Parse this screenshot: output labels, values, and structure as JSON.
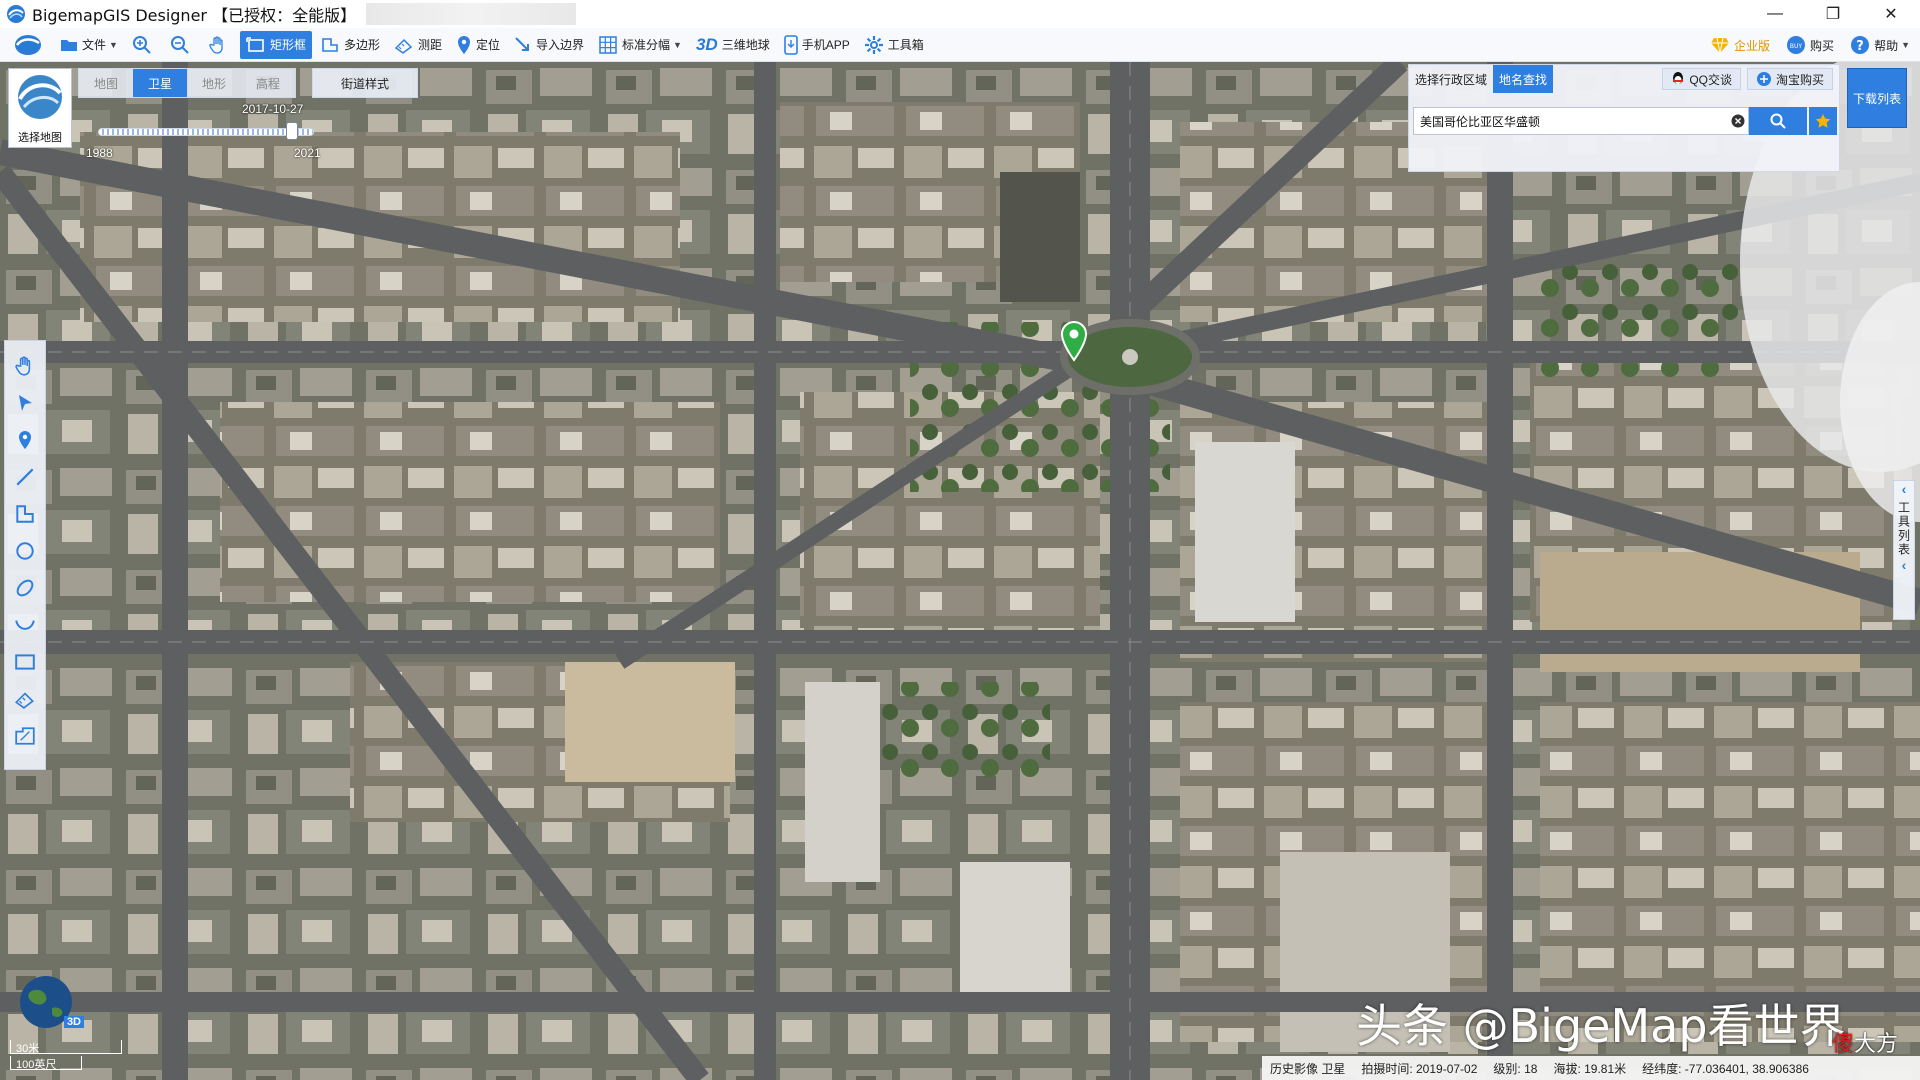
{
  "window": {
    "title": "BigemapGIS Designer 【已授权：全能版】",
    "controls": [
      "—",
      "❐",
      "✕"
    ]
  },
  "toolbar": {
    "items": [
      {
        "label": "文件",
        "icon": "folder-icon",
        "dropdown": true
      },
      {
        "label": "",
        "icon": "zoom-in-icon"
      },
      {
        "label": "",
        "icon": "zoom-out-icon"
      },
      {
        "label": "",
        "icon": "hand-pan-icon"
      },
      {
        "label": "矩形框",
        "icon": "rectangle-select-icon",
        "active": true
      },
      {
        "label": "多边形",
        "icon": "polygon-select-icon"
      },
      {
        "label": "测距",
        "icon": "ruler-icon"
      },
      {
        "label": "定位",
        "icon": "location-pin-icon"
      },
      {
        "label": "导入边界",
        "icon": "import-boundary-icon"
      },
      {
        "label": "标准分幅",
        "icon": "grid-icon",
        "dropdown": true
      },
      {
        "label": "三维地球",
        "icon": "3d-icon"
      },
      {
        "label": "手机APP",
        "icon": "phone-icon"
      },
      {
        "label": "工具箱",
        "icon": "gear-icon"
      }
    ],
    "right": [
      {
        "label": "企业版",
        "icon": "diamond-icon"
      },
      {
        "label": "购买",
        "icon": "buy-icon"
      },
      {
        "label": "帮助",
        "icon": "help-icon",
        "dropdown": true
      }
    ],
    "label_3d": "3D"
  },
  "map_types": {
    "tabs": [
      "地图",
      "卫星",
      "地形",
      "高程"
    ],
    "active": "卫星",
    "street_style": "街道样式"
  },
  "select_map": {
    "label": "选择地图"
  },
  "timeline": {
    "current_date": "2017-10-27",
    "start_year": "1988",
    "end_year": "2021",
    "position": 0.9
  },
  "search": {
    "tabs": [
      "选择行政区域",
      "地名查找"
    ],
    "active_tab": "地名查找",
    "qq_label": "QQ交谈",
    "taobao_label": "淘宝购买",
    "value": "美国哥伦比亚区华盛顿"
  },
  "download_list": "下载列表",
  "tool_list": "工具列表",
  "globe_label": "3D",
  "scale": {
    "meters": "30米",
    "feet": "100英尺"
  },
  "watermark": {
    "main": "头条 @BigeMap看世界",
    "sub_a": "傻",
    "sub_b": "大方"
  },
  "status": {
    "layer": "历史影像 卫星",
    "capture_time": "拍摄时间: 2019-07-02",
    "level": "级别:  18",
    "altitude": "海拔: 19.81米",
    "coords": "经纬度:  -77.036401, 38.906386"
  },
  "colors": {
    "accent": "#2f7fe0",
    "pin": "#2fae46"
  }
}
